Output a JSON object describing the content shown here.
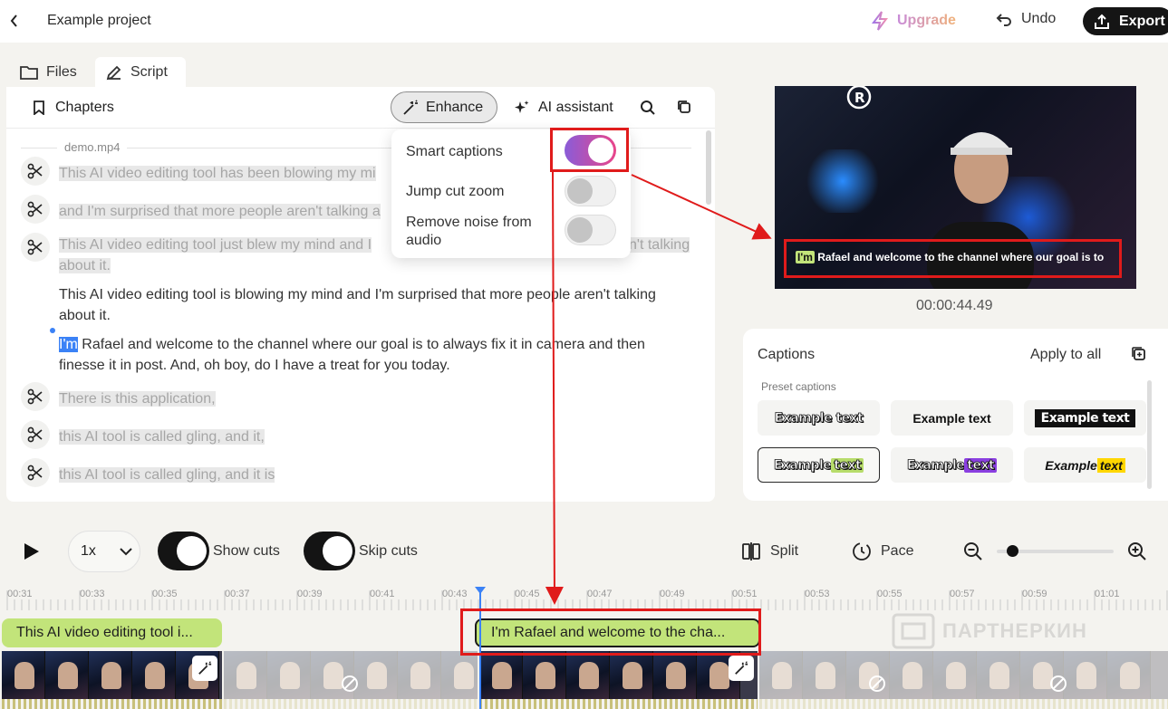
{
  "topbar": {
    "project_name": "Example project",
    "upgrade_label": "Upgrade",
    "undo_label": "Undo",
    "export_label": "Export"
  },
  "tabs": [
    {
      "label": "Files",
      "icon": "folder-icon"
    },
    {
      "label": "Script",
      "icon": "pencil-icon",
      "active": true
    }
  ],
  "script_toolbar": {
    "chapters_label": "Chapters",
    "enhance_label": "Enhance",
    "ai_assistant_label": "AI assistant"
  },
  "script": {
    "file_name": "demo.mp4",
    "segments": [
      {
        "type": "cut",
        "text": "This AI video editing tool has been blowing my mi"
      },
      {
        "type": "cut",
        "text": "and I'm surprised that more people aren't talking a"
      },
      {
        "type": "cut",
        "text_line1": "This AI video editing tool just blew my mind and I",
        "text_tail": "n't talking",
        "text_line2": "about it."
      },
      {
        "type": "kept",
        "text": "This AI video editing tool is blowing my mind and I'm surprised that more people aren't talking about it."
      },
      {
        "type": "kept",
        "selected_word": "I'm",
        "text": " Rafael and welcome to the channel where our goal is to always fix it in camera and then finesse it in post. And, oh boy, do I have a treat for you today."
      },
      {
        "type": "cut",
        "text": "There is this application,"
      },
      {
        "type": "cut",
        "text": "this AI tool is called gling, and it,"
      },
      {
        "type": "cut",
        "text": "this AI tool is called gling, and it is"
      }
    ]
  },
  "enhance_menu": {
    "items": [
      {
        "label": "Smart captions",
        "on": true
      },
      {
        "label": "Jump cut zoom",
        "on": false
      },
      {
        "label": "Remove noise from audio",
        "on": false
      }
    ]
  },
  "video": {
    "caption_word": "I'm",
    "caption_text": " Rafael and welcome to the channel where our goal is to",
    "timestamp": "00:00:44.49"
  },
  "captions_panel": {
    "title": "Captions",
    "apply_all_label": "Apply to all",
    "preset_label": "Preset captions",
    "presets": [
      {
        "text": "Example text",
        "style": "outline"
      },
      {
        "text": "Example text",
        "style": "plain"
      },
      {
        "text": "Example text",
        "style": "black-box"
      },
      {
        "text_a": "Example ",
        "text_b": "text",
        "style": "outline-green",
        "selected": true
      },
      {
        "text_a": "Example ",
        "text_b": "text",
        "style": "outline-purple"
      },
      {
        "text_a": "Example ",
        "text_b": "text",
        "style": "italic-yellow"
      }
    ]
  },
  "playback": {
    "speed": "1x",
    "show_cuts_label": "Show cuts",
    "skip_cuts_label": "Skip cuts",
    "split_label": "Split",
    "pace_label": "Pace",
    "zoom_level": 0.1
  },
  "timeline": {
    "ticks": [
      "00:31",
      "00:33",
      "00:35",
      "00:37",
      "00:39",
      "00:41",
      "00:43",
      "00:45",
      "00:47",
      "00:49",
      "00:51",
      "00:53",
      "00:55",
      "00:57",
      "00:59",
      "01:01"
    ],
    "clips": [
      {
        "label": "This AI video editing tool i..."
      },
      {
        "label": "I'm Rafael and welcome to the cha..."
      }
    ],
    "watermark": "ПАРТНЕРКИН"
  },
  "colors": {
    "accent_blue": "#3b82f6",
    "clip_green": "#c2e47a",
    "annotation_red": "#e01b1b",
    "export_black": "#151515"
  }
}
